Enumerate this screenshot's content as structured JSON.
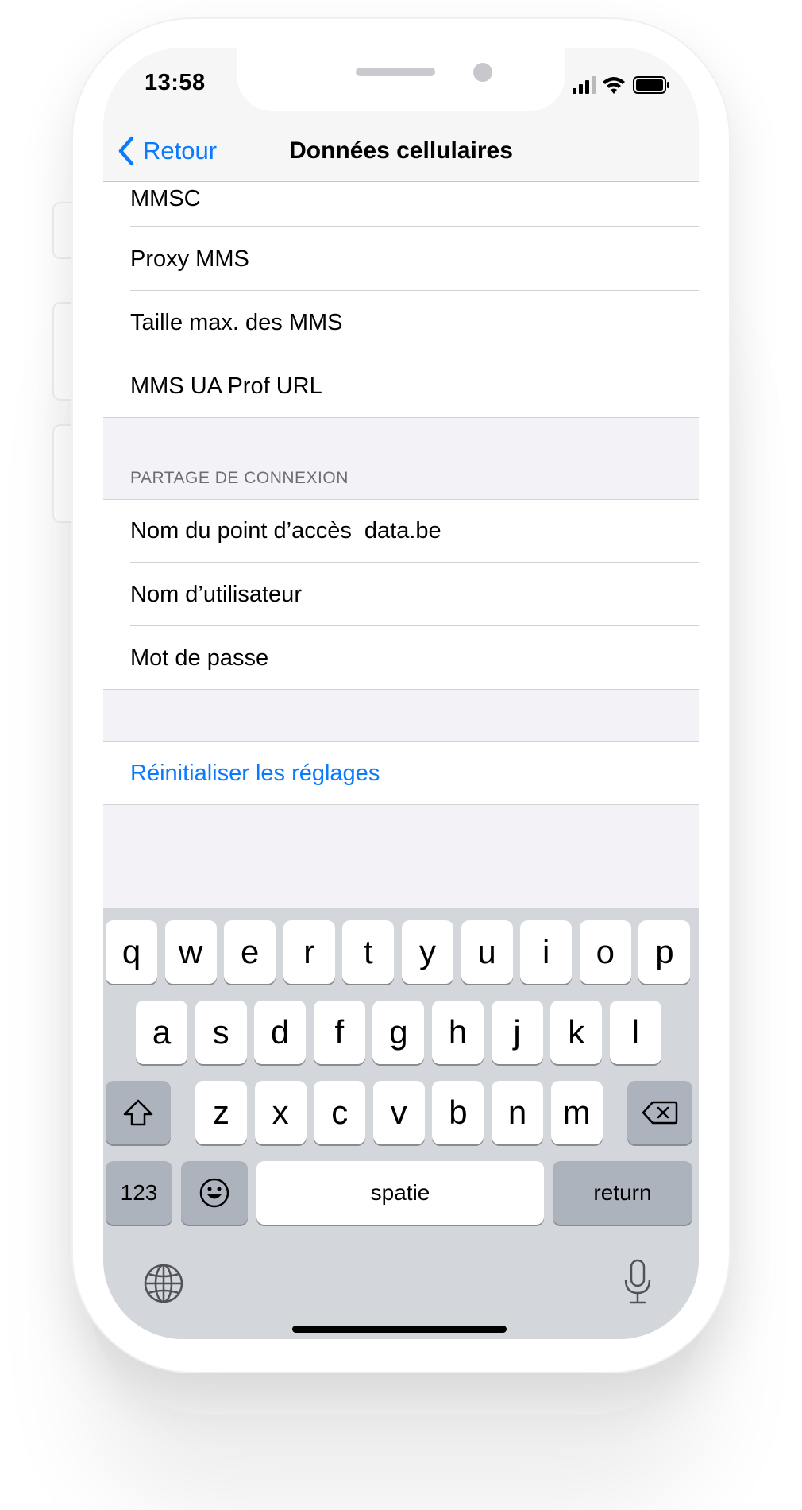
{
  "status_bar": {
    "time": "13:58"
  },
  "nav": {
    "back_label": "Retour",
    "title": "Données cellulaires"
  },
  "mms_group": {
    "rows": [
      {
        "label": "MMSC"
      },
      {
        "label": "Proxy MMS"
      },
      {
        "label": "Taille max. des MMS"
      },
      {
        "label": "MMS UA Prof URL"
      }
    ]
  },
  "tethering": {
    "header": "PARTAGE DE CONNEXION",
    "rows": [
      {
        "label": "Nom du point d’accès",
        "value": "data.be"
      },
      {
        "label": "Nom d’utilisateur",
        "value": ""
      },
      {
        "label": "Mot de passe",
        "value": ""
      }
    ]
  },
  "reset": {
    "label": "Réinitialiser les réglages"
  },
  "keyboard": {
    "row1": [
      "q",
      "w",
      "e",
      "r",
      "t",
      "y",
      "u",
      "i",
      "o",
      "p"
    ],
    "row2": [
      "a",
      "s",
      "d",
      "f",
      "g",
      "h",
      "j",
      "k",
      "l"
    ],
    "row3": [
      "z",
      "x",
      "c",
      "v",
      "b",
      "n",
      "m"
    ],
    "numbers_label": "123",
    "space_label": "spatie",
    "return_label": "return"
  },
  "colors": {
    "accent": "#0a7aff",
    "grouped_background": "#f2f2f7",
    "keyboard_background": "#d3d6db"
  },
  "icons": [
    "chevron-left-icon",
    "signal-icon",
    "wifi-icon",
    "battery-icon",
    "shift-icon",
    "delete-icon",
    "emoji-icon",
    "globe-icon",
    "microphone-icon"
  ]
}
